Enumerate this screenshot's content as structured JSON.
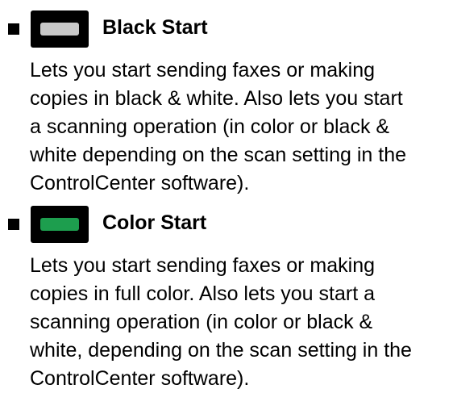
{
  "entries": [
    {
      "title": "Black Start",
      "key_color": "#c8c8c8",
      "key_icon": "black-start-key-icon",
      "lines": [
        "Lets you start sending faxes or making",
        "copies in black & white. Also lets you start",
        "a scanning operation (in color or black &",
        "white depending on the scan setting in the",
        "ControlCenter software)."
      ]
    },
    {
      "title": "Color Start",
      "key_color": "#1d9e4e",
      "key_icon": "color-start-key-icon",
      "lines": [
        "Lets you start sending faxes or making",
        "copies in full color. Also lets you start a",
        "scanning operation (in color or black &",
        "white, depending on the scan setting in the",
        "ControlCenter software)."
      ]
    }
  ],
  "colors": {
    "text": "#000000",
    "background": "#ffffff",
    "key_frame": "#000000"
  }
}
